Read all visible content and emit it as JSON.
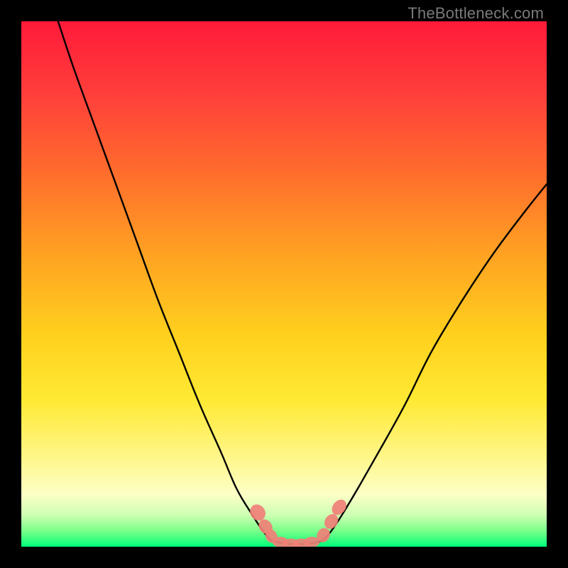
{
  "watermark": "TheBottleneck.com",
  "chart_data": {
    "type": "line",
    "title": "",
    "xlabel": "",
    "ylabel": "",
    "xlim": [
      0,
      100
    ],
    "ylim": [
      0,
      100
    ],
    "grid": false,
    "legend": false,
    "series": [
      {
        "name": "left-curve",
        "color": "#000000",
        "x": [
          7,
          10,
          14,
          18,
          22,
          26,
          30,
          34,
          38,
          41,
          44,
          46,
          47.5
        ],
        "y": [
          100,
          91,
          80,
          69,
          58,
          47,
          37,
          27,
          18,
          11,
          6,
          3,
          1.2
        ]
      },
      {
        "name": "right-curve",
        "color": "#000000",
        "x": [
          57.5,
          59,
          61,
          64,
          68,
          73,
          78,
          84,
          90,
          96,
          100
        ],
        "y": [
          1.2,
          3,
          6,
          11,
          18,
          27,
          37,
          47,
          56,
          64,
          69
        ]
      },
      {
        "name": "valley-floor",
        "color": "#000000",
        "x": [
          47.5,
          50,
          52.5,
          55,
          57.5
        ],
        "y": [
          1.2,
          0.6,
          0.5,
          0.6,
          1.2
        ]
      }
    ],
    "markers": [
      {
        "name": "left-marker-a",
        "x": 45.0,
        "y": 6.5,
        "rx": 1.4,
        "ry": 1.6,
        "rot": -35,
        "color": "#f08078"
      },
      {
        "name": "left-marker-b",
        "x": 46.5,
        "y": 3.8,
        "rx": 1.2,
        "ry": 1.5,
        "rot": -35,
        "color": "#f08078"
      },
      {
        "name": "left-marker-c",
        "x": 47.6,
        "y": 2.0,
        "rx": 1.1,
        "ry": 1.3,
        "rot": -25,
        "color": "#f08078"
      },
      {
        "name": "floor-marker-a",
        "x": 49.3,
        "y": 0.9,
        "rx": 1.5,
        "ry": 1.0,
        "rot": 0,
        "color": "#f08078"
      },
      {
        "name": "floor-marker-b",
        "x": 51.3,
        "y": 0.55,
        "rx": 1.6,
        "ry": 1.0,
        "rot": 0,
        "color": "#f08078"
      },
      {
        "name": "floor-marker-c",
        "x": 53.3,
        "y": 0.55,
        "rx": 1.6,
        "ry": 1.0,
        "rot": 0,
        "color": "#f08078"
      },
      {
        "name": "floor-marker-d",
        "x": 55.3,
        "y": 0.9,
        "rx": 1.5,
        "ry": 1.0,
        "rot": 0,
        "color": "#f08078"
      },
      {
        "name": "right-marker-a",
        "x": 57.5,
        "y": 2.2,
        "rx": 1.2,
        "ry": 1.4,
        "rot": 30,
        "color": "#f08078"
      },
      {
        "name": "right-marker-b",
        "x": 59.0,
        "y": 4.8,
        "rx": 1.2,
        "ry": 1.5,
        "rot": 35,
        "color": "#f08078"
      },
      {
        "name": "right-marker-c",
        "x": 60.5,
        "y": 7.5,
        "rx": 1.2,
        "ry": 1.6,
        "rot": 40,
        "color": "#f08078"
      }
    ],
    "gradient_stops": [
      {
        "pos": 0,
        "color": "#ff1a3a"
      },
      {
        "pos": 14,
        "color": "#ff3f3b"
      },
      {
        "pos": 28,
        "color": "#ff6a2d"
      },
      {
        "pos": 45,
        "color": "#ffa422"
      },
      {
        "pos": 60,
        "color": "#ffd11e"
      },
      {
        "pos": 72,
        "color": "#ffe933"
      },
      {
        "pos": 83,
        "color": "#fff68a"
      },
      {
        "pos": 90,
        "color": "#fdffc6"
      },
      {
        "pos": 94,
        "color": "#cdffb2"
      },
      {
        "pos": 97,
        "color": "#7aff8a"
      },
      {
        "pos": 100,
        "color": "#00ff7a"
      }
    ]
  }
}
